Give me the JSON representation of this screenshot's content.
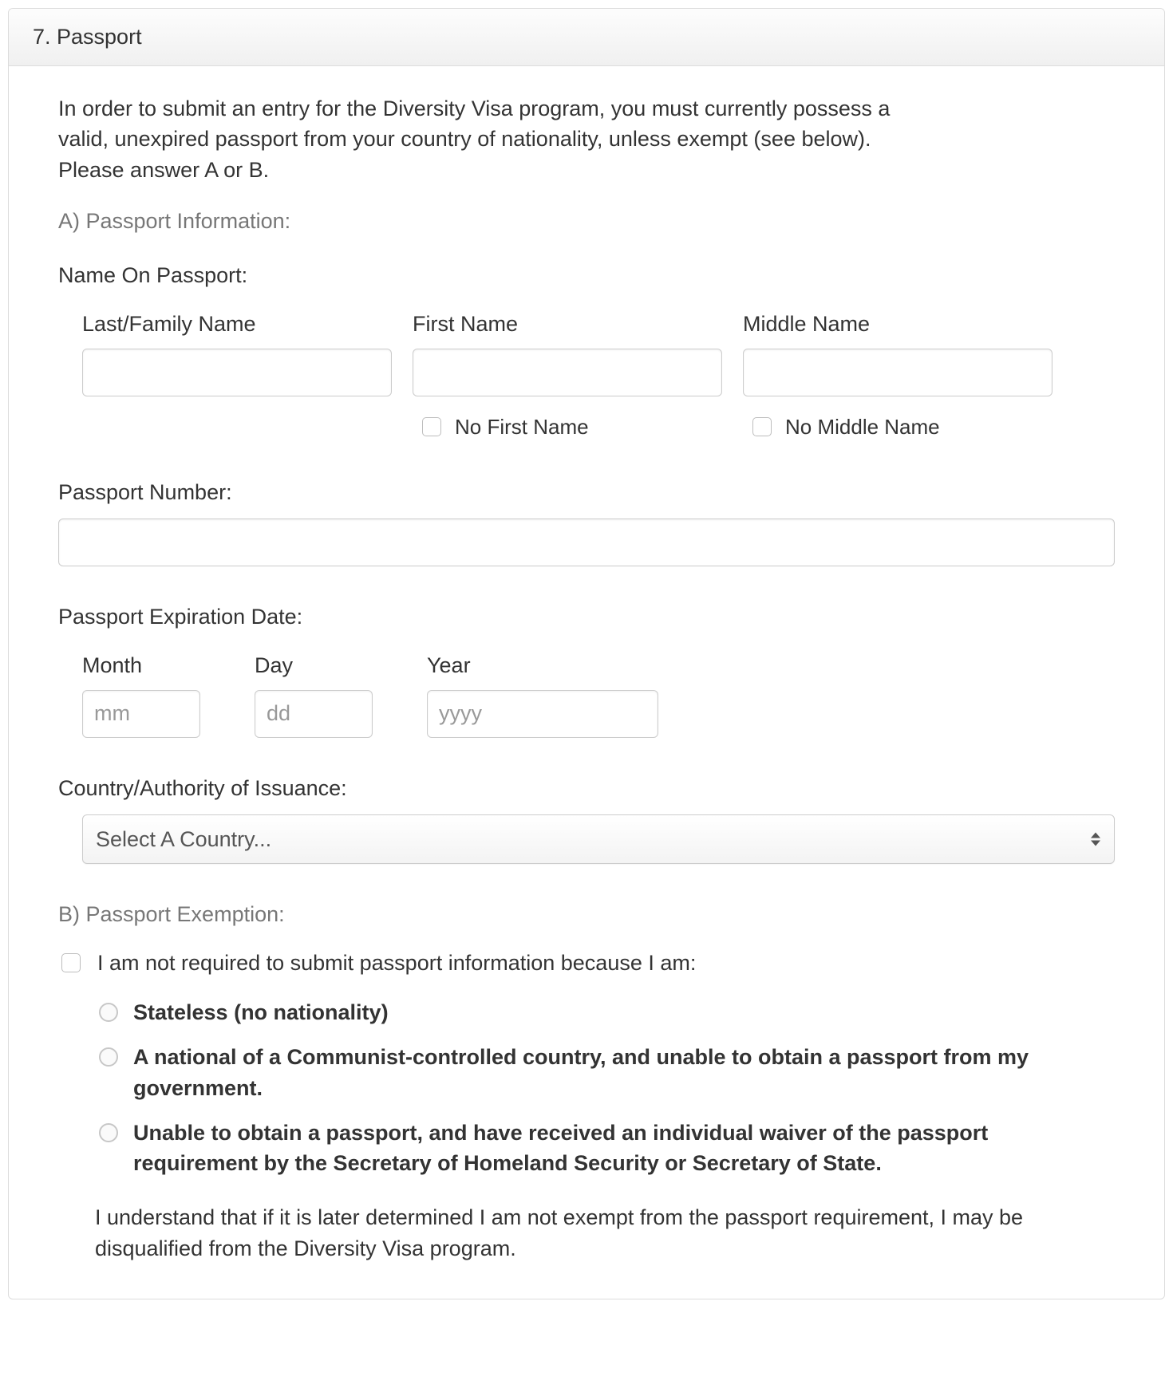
{
  "panel": {
    "title": "7. Passport",
    "intro": "In order to submit an entry for the Diversity Visa program, you must currently possess a valid, unexpired passport from your country of nationality, unless exempt (see below). Please answer A or B.",
    "sectionA": {
      "label": "A) Passport Information:",
      "nameOnPassport": {
        "label": "Name On Passport:",
        "lastName": {
          "label": "Last/Family Name",
          "value": ""
        },
        "firstName": {
          "label": "First Name",
          "value": "",
          "noFirstNameLabel": "No First Name",
          "noFirstNameChecked": false
        },
        "middleName": {
          "label": "Middle Name",
          "value": "",
          "noMiddleNameLabel": "No Middle Name",
          "noMiddleNameChecked": false
        }
      },
      "passportNumber": {
        "label": "Passport Number:",
        "value": ""
      },
      "expiration": {
        "label": "Passport Expiration Date:",
        "month": {
          "label": "Month",
          "placeholder": "mm",
          "value": ""
        },
        "day": {
          "label": "Day",
          "placeholder": "dd",
          "value": ""
        },
        "year": {
          "label": "Year",
          "placeholder": "yyyy",
          "value": ""
        }
      },
      "issuance": {
        "label": "Country/Authority of Issuance:",
        "selected": "Select A Country..."
      }
    },
    "sectionB": {
      "label": "B) Passport Exemption:",
      "exemptionCheckboxLabel": "I am not required to submit passport information because I am:",
      "exemptionCheckboxChecked": false,
      "options": [
        "Stateless (no nationality)",
        "A national of a Communist-controlled country, and unable to obtain a passport from my government.",
        "Unable to obtain a passport, and have received an individual waiver of the passport requirement by the Secretary of Homeland Security or Secretary of State."
      ],
      "disclaimer": "I understand that if it is later determined I am not exempt from the passport requirement, I may be disqualified from the Diversity Visa program."
    }
  }
}
